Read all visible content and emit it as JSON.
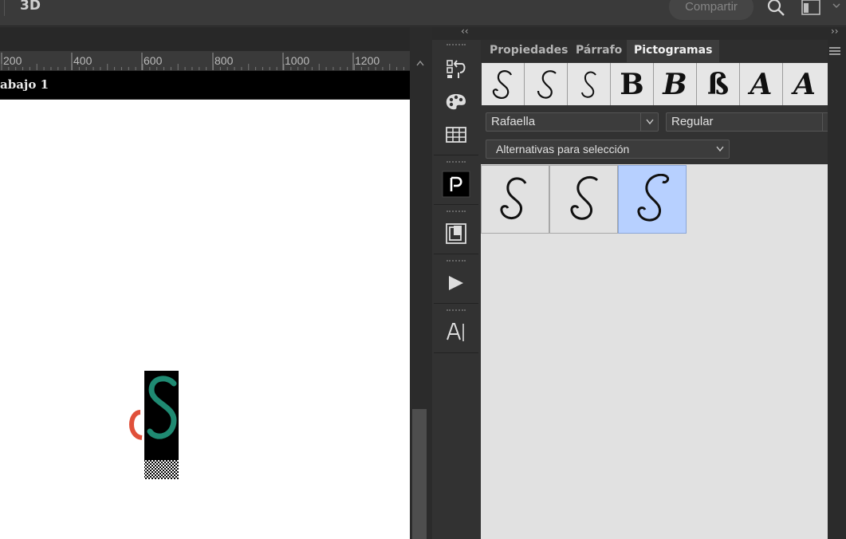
{
  "topbar": {
    "mode_label": "3D",
    "share_label": "Compartir",
    "icons": [
      "search-icon",
      "workspace-icon",
      "chevron-down-icon"
    ]
  },
  "document": {
    "tab_title": "abajo 1",
    "ruler_marks": [
      "200",
      "400",
      "600",
      "800",
      "1000",
      "1200"
    ]
  },
  "dock": {
    "collapse_left": "‹‹",
    "collapse_right": "››",
    "strip_icons": [
      "history-icon",
      "palette-icon",
      "table-icon",
      "glyph-p-icon",
      "artboard-icon",
      "play-icon",
      "character-icon"
    ]
  },
  "panel": {
    "tabs": [
      {
        "label": "Propiedades",
        "active": false
      },
      {
        "label": "Párrafo",
        "active": false
      },
      {
        "label": "Pictogramas",
        "active": true
      }
    ],
    "recent_glyphs": [
      "S",
      "S",
      "S",
      "B",
      "B",
      "ß",
      "A",
      "A"
    ],
    "font_family": "Rafaella",
    "font_style": "Regular",
    "filter": "Alternativas para selección",
    "alternates": [
      "S",
      "S",
      "S"
    ],
    "selected_index": 2
  },
  "colors": {
    "accent_selected": "#b7d0ff",
    "teal_letter": "#1f8a72",
    "orange_letter": "#e0503a"
  }
}
